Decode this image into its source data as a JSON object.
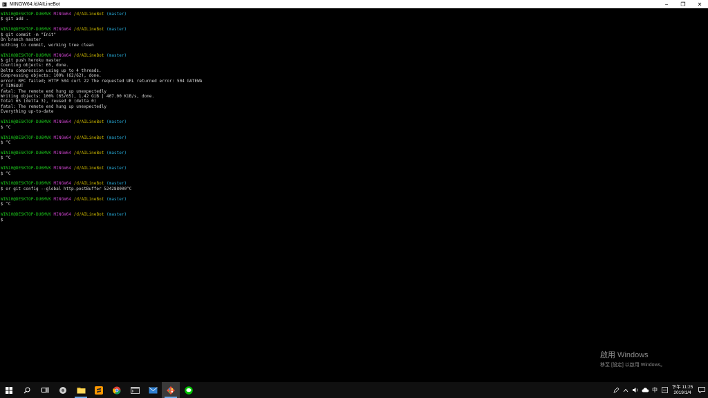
{
  "window": {
    "title": "MINGW64:/d/AILineBot",
    "minimize_label": "−",
    "maximize_label": "❐",
    "close_label": "✕"
  },
  "terminal": {
    "prompt": {
      "host": "WIN10@DESKTOP-DU6MVK",
      "env": "MINGW64",
      "path": "/d/AILineBot",
      "branch": "(master)"
    },
    "lines": [
      {
        "type": "prompt"
      },
      {
        "type": "text",
        "text": "$ git add ."
      },
      {
        "type": "blank"
      },
      {
        "type": "prompt"
      },
      {
        "type": "text",
        "text": "$ git commit -m \"Init\""
      },
      {
        "type": "text",
        "text": "On branch master"
      },
      {
        "type": "text",
        "text": "nothing to commit, working tree clean"
      },
      {
        "type": "blank"
      },
      {
        "type": "prompt"
      },
      {
        "type": "text",
        "text": "$ git push heroku master"
      },
      {
        "type": "text",
        "text": "Counting objects: 65, done."
      },
      {
        "type": "text",
        "text": "Delta compression using up to 4 threads."
      },
      {
        "type": "text",
        "text": "Compressing objects: 100% (62/62), done."
      },
      {
        "type": "text",
        "text": "error: RPC failed; HTTP 504 curl 22 The requested URL returned error: 504 GATEWA"
      },
      {
        "type": "text",
        "text": "Y_TIMEOUT"
      },
      {
        "type": "text",
        "text": "fatal: The remote end hung up unexpectedly"
      },
      {
        "type": "text",
        "text": "Writing objects: 100% (65/65), 1.42 GiB | 407.00 KiB/s, done."
      },
      {
        "type": "text",
        "text": "Total 65 (delta 3), reused 0 (delta 0)"
      },
      {
        "type": "text",
        "text": "fatal: The remote end hung up unexpectedly"
      },
      {
        "type": "text",
        "text": "Everything up-to-date"
      },
      {
        "type": "blank"
      },
      {
        "type": "prompt"
      },
      {
        "type": "text",
        "text": "$ ^C"
      },
      {
        "type": "blank"
      },
      {
        "type": "prompt"
      },
      {
        "type": "text",
        "text": "$ ^C"
      },
      {
        "type": "blank"
      },
      {
        "type": "prompt"
      },
      {
        "type": "text",
        "text": "$ ^C"
      },
      {
        "type": "blank"
      },
      {
        "type": "prompt"
      },
      {
        "type": "text",
        "text": "$ ^C"
      },
      {
        "type": "blank"
      },
      {
        "type": "prompt"
      },
      {
        "type": "text",
        "text": "$ or git config --global http.postBuffer 524288000^C"
      },
      {
        "type": "blank"
      },
      {
        "type": "prompt"
      },
      {
        "type": "text",
        "text": "$ ^C"
      },
      {
        "type": "blank"
      },
      {
        "type": "prompt"
      },
      {
        "type": "text",
        "text": "$"
      }
    ]
  },
  "watermark": {
    "line1": "啟用 Windows",
    "line2": "移至 [設定] 以啟用 Windows。"
  },
  "taskbar": {
    "apps": [
      {
        "name": "start-button",
        "icon": "windows-logo-icon"
      },
      {
        "name": "search-button",
        "icon": "search-icon"
      },
      {
        "name": "task-view-button",
        "icon": "task-view-icon"
      },
      {
        "name": "taskbar-app-1",
        "icon": "app-icon"
      },
      {
        "name": "taskbar-file-explorer",
        "icon": "folder-icon"
      },
      {
        "name": "taskbar-sublime",
        "icon": "sublime-icon"
      },
      {
        "name": "taskbar-chrome",
        "icon": "chrome-icon"
      },
      {
        "name": "taskbar-terminal",
        "icon": "terminal-icon"
      },
      {
        "name": "taskbar-mail",
        "icon": "mail-icon"
      },
      {
        "name": "taskbar-git-bash",
        "icon": "git-icon"
      },
      {
        "name": "taskbar-line",
        "icon": "line-icon"
      }
    ],
    "ime_label": "中",
    "clock_time": "下午 11:25",
    "clock_date": "2019/1/4"
  },
  "colors": {
    "host": "#1cc41c",
    "mingw": "#c040c0",
    "path": "#c8b400",
    "branch": "#27a9d6",
    "text": "#d4d4d4"
  }
}
